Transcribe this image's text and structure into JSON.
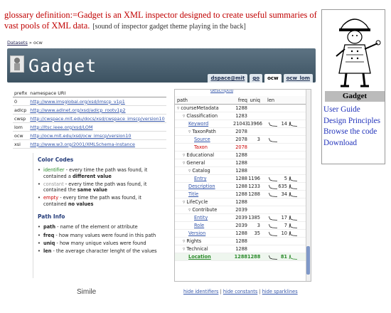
{
  "headline": {
    "definition": "glossary definition:=Gadget is an XML inspector designed to create useful summaries of vast pools of XML data.",
    "note": "[sound of inspector gadget theme playing in the back]"
  },
  "breadcrumb": {
    "item1": "Datasets",
    "sep": "»",
    "item2": "ocw"
  },
  "app": {
    "title": "Gadget"
  },
  "tabs": [
    "dspace@mit",
    "go",
    "ocw",
    "ocw_lom"
  ],
  "namespaces": {
    "header": {
      "prefix": "prefix",
      "uri": "namespace URI"
    },
    "rows": [
      {
        "prefix": "0",
        "uri": "http://www.imsglobal.org/xsd/imscp_v1p1"
      },
      {
        "prefix": "adlcp",
        "uri": "http://www.adlnet.org/xsd/adlcp_rootv1p2"
      },
      {
        "prefix": "cwsp",
        "uri": "http://cwspace.mit.edu/docs/xsd/cwspace_imscp/version10"
      },
      {
        "prefix": "lom",
        "uri": "http://ltsc.ieee.org/xsd/LOM"
      },
      {
        "prefix": "ocw",
        "uri": "http://ocw.mit.edu/xsd/ocw_imscp/version10"
      },
      {
        "prefix": "xsi",
        "uri": "http://www.w3.org/2001/XMLSchema-instance"
      }
    ]
  },
  "legend": {
    "color_title": "Color Codes",
    "identifier_word": "identifier",
    "identifier_text": " - every time the path was found, it contained a ",
    "identifier_strong": "different value",
    "constant_word": "constant",
    "constant_text": " - every time the path was found, it contained the ",
    "constant_strong": "same value",
    "empty_word": "empty",
    "empty_text": " - every time the path was found, it contained ",
    "empty_strong": "no values",
    "path_title": "Path Info",
    "path_word": "path",
    "path_text": " - name of the element or attribute",
    "freq_word": "freq",
    "freq_text": " - how many values were found in this path",
    "uniq_word": "uniq",
    "uniq_text": " - how many unique values were found",
    "len_word": "len",
    "len_text": " - the average character lenght of the values"
  },
  "simile": "Simile",
  "tree": {
    "top_cut": "description",
    "headers": {
      "path": "path",
      "freq": "freq",
      "uniq": "uniq",
      "len": "len"
    },
    "rows": [
      {
        "indent": 0,
        "label": "courseMetadata",
        "freq": "1288",
        "uniq": "",
        "len": "",
        "kind": "node"
      },
      {
        "indent": 1,
        "label": "Classification",
        "freq": "1283",
        "uniq": "",
        "len": "",
        "kind": "node"
      },
      {
        "indent": 2,
        "label": "Keyword",
        "freq": "21043",
        "uniq": "13966",
        "len": "14",
        "kind": "link"
      },
      {
        "indent": 2,
        "label": "TaxonPath",
        "freq": "2078",
        "uniq": "",
        "len": "",
        "kind": "node"
      },
      {
        "indent": 3,
        "label": "Source",
        "freq": "2078",
        "uniq": "3",
        "len": "",
        "kind": "link"
      },
      {
        "indent": 3,
        "label": "Taxon",
        "freq": "2078",
        "uniq": "",
        "len": "",
        "kind": "red"
      },
      {
        "indent": 1,
        "label": "Educational",
        "freq": "1288",
        "uniq": "",
        "len": "",
        "kind": "node"
      },
      {
        "indent": 1,
        "label": "General",
        "freq": "1288",
        "uniq": "",
        "len": "",
        "kind": "node"
      },
      {
        "indent": 2,
        "label": "Catalog",
        "freq": "1288",
        "uniq": "",
        "len": "",
        "kind": "node"
      },
      {
        "indent": 3,
        "label": "Entry",
        "freq": "1288",
        "uniq": "1196",
        "len": "5",
        "kind": "link"
      },
      {
        "indent": 2,
        "label": "Description",
        "freq": "1288",
        "uniq": "1233",
        "len": "635",
        "kind": "link"
      },
      {
        "indent": 2,
        "label": "Title",
        "freq": "1288",
        "uniq": "1288",
        "len": "34",
        "kind": "link"
      },
      {
        "indent": 1,
        "label": "LifeCycle",
        "freq": "1288",
        "uniq": "",
        "len": "",
        "kind": "node"
      },
      {
        "indent": 2,
        "label": "Contribute",
        "freq": "2039",
        "uniq": "",
        "len": "",
        "kind": "node"
      },
      {
        "indent": 3,
        "label": "Entity",
        "freq": "2039",
        "uniq": "1385",
        "len": "17",
        "kind": "link"
      },
      {
        "indent": 3,
        "label": "Role",
        "freq": "2039",
        "uniq": "3",
        "len": "7",
        "kind": "link"
      },
      {
        "indent": 2,
        "label": "Version",
        "freq": "1288",
        "uniq": "35",
        "len": "10",
        "kind": "link"
      },
      {
        "indent": 1,
        "label": "Rights",
        "freq": "1288",
        "uniq": "",
        "len": "",
        "kind": "node"
      },
      {
        "indent": 1,
        "label": "Technical",
        "freq": "1288",
        "uniq": "",
        "len": "",
        "kind": "node"
      },
      {
        "indent": 2,
        "label": "Location",
        "freq": "1288",
        "uniq": "1288",
        "len": "81",
        "kind": "ident"
      }
    ]
  },
  "hide_links": {
    "a": "hide identifiers",
    "b": "hide constants",
    "c": "hide sparklines",
    "sep": "|"
  },
  "sidebar": {
    "label": "Gadget",
    "links": [
      "User Guide",
      "Design Principles",
      "Browse the code",
      "Download"
    ]
  }
}
